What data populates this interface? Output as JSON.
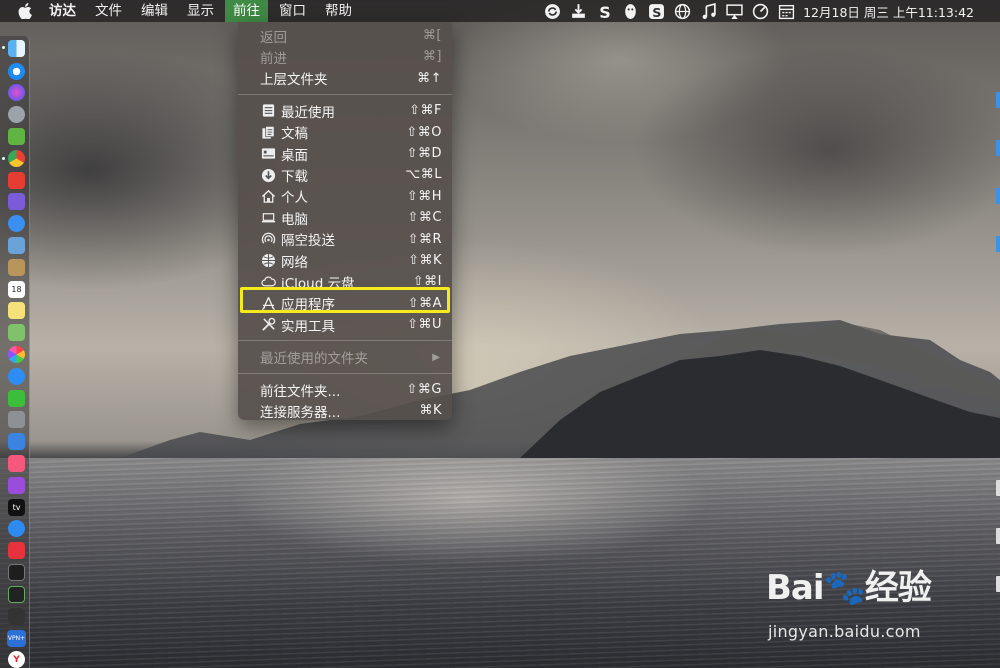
{
  "menubar": {
    "apple_icon": "apple-icon",
    "items": [
      "访达",
      "文件",
      "编辑",
      "显示",
      "前往",
      "窗口",
      "帮助"
    ],
    "active_item": "前往",
    "status_icons": [
      "sync-circle-icon",
      "download-tray-icon",
      "s-logo-icon",
      "qq-penguin-icon",
      "sogou-s-icon",
      "globe-icon",
      "music-note-icon",
      "airplay-display-icon",
      "speed-gauge-icon",
      "calendar-icon"
    ],
    "clock": "12月18日 周三 上午11:13:42"
  },
  "go_menu": {
    "sections": [
      [
        {
          "label": "返回",
          "shortcut": "⌘[",
          "disabled": true,
          "icon": ""
        },
        {
          "label": "前进",
          "shortcut": "⌘]",
          "disabled": true,
          "icon": ""
        },
        {
          "label": "上层文件夹",
          "shortcut": "⌘↑",
          "disabled": false,
          "icon": ""
        }
      ],
      [
        {
          "label": "最近使用",
          "shortcut": "⇧⌘F",
          "icon": "recents-icon"
        },
        {
          "label": "文稿",
          "shortcut": "⇧⌘O",
          "icon": "documents-icon"
        },
        {
          "label": "桌面",
          "shortcut": "⇧⌘D",
          "icon": "desktop-icon"
        },
        {
          "label": "下载",
          "shortcut": "⌥⌘L",
          "icon": "downloads-icon"
        },
        {
          "label": "个人",
          "shortcut": "⇧⌘H",
          "icon": "home-icon"
        },
        {
          "label": "电脑",
          "shortcut": "⇧⌘C",
          "icon": "computer-icon"
        },
        {
          "label": "隔空投送",
          "shortcut": "⇧⌘R",
          "icon": "airdrop-icon"
        },
        {
          "label": "网络",
          "shortcut": "⇧⌘K",
          "icon": "network-icon"
        },
        {
          "label": "iCloud 云盘",
          "shortcut": "⇧⌘I",
          "icon": "icloud-icon"
        },
        {
          "label": "应用程序",
          "shortcut": "⇧⌘A",
          "icon": "applications-icon",
          "highlighted": true
        },
        {
          "label": "实用工具",
          "shortcut": "⇧⌘U",
          "icon": "utilities-icon"
        }
      ],
      [
        {
          "label": "最近使用的文件夹",
          "shortcut": "",
          "disabled": true,
          "submenu": "▶"
        }
      ],
      [
        {
          "label": "前往文件夹...",
          "shortcut": "⇧⌘G"
        },
        {
          "label": "连接服务器...",
          "shortcut": "⌘K"
        }
      ]
    ]
  },
  "dock": {
    "icons": [
      "finder-icon",
      "safari-icon",
      "siri-icon",
      "launchpad-icon",
      "android-icon",
      "chrome-icon",
      "notes-pin-icon",
      "floppy-icon",
      "compass-icon",
      "preview-icon",
      "notebook-icon",
      "calendar-icon",
      "stickies-icon",
      "maps-icon",
      "photos-icon",
      "messages-icon",
      "wechat-icon",
      "system-preferences-icon",
      "keynote-icon",
      "music-icon",
      "podcasts-icon",
      "apple-tv-icon",
      "app-store-icon",
      "vivaldi-icon",
      "terminal-icon",
      "activity-monitor-icon",
      "script-icon",
      "vpn-icon",
      "yandex-icon"
    ],
    "calendar_day": "18",
    "tv_label": "tv",
    "vpn_label": "VPN+",
    "yandex_label": "Y"
  },
  "watermark": {
    "logo": "Bai🐾经验",
    "url": "jingyan.baidu.com"
  },
  "colors": {
    "menu_active": "#3f8a45",
    "highlight_box": "#f5eb1a",
    "menu_bg": "#56504c"
  }
}
